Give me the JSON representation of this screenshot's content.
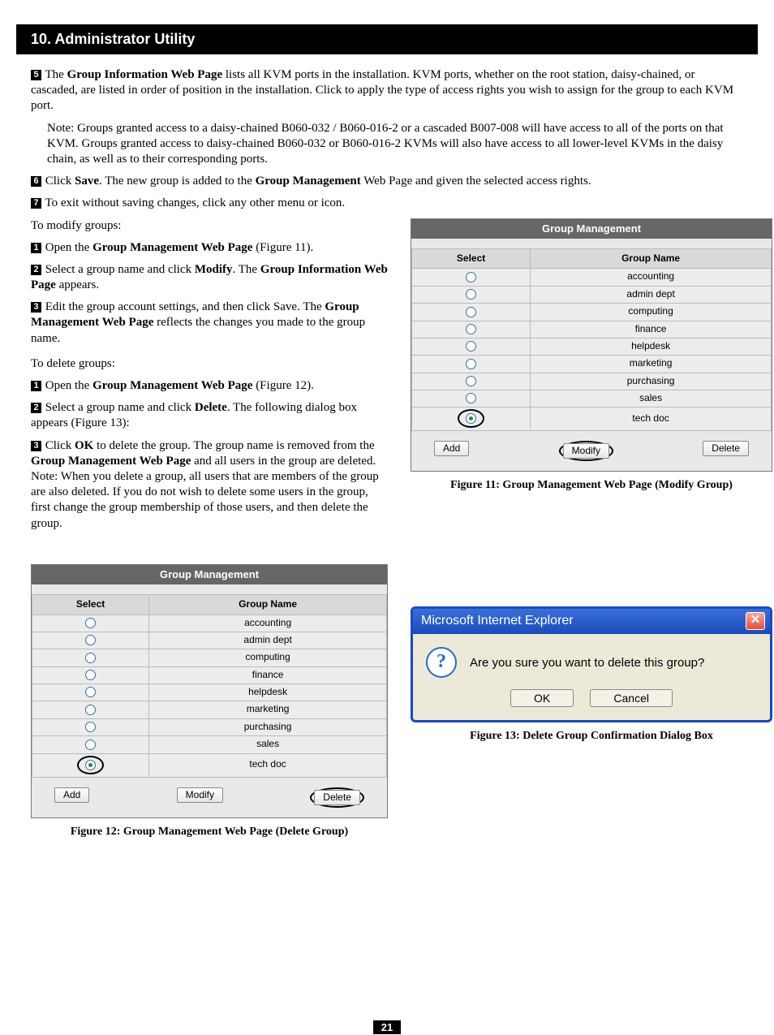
{
  "header": {
    "title": "10. Administrator Utility"
  },
  "page_number": "21",
  "top_paras": {
    "n5": "5",
    "p5a": "The ",
    "p5b_bold": "Group Information Web Page",
    "p5c": " lists all KVM ports in the installation. KVM ports, whether on the root station, daisy-chained, or cascaded, are listed in order of position in the installation. Click to apply the type of access rights you wish to assign for the group to each KVM port.",
    "note": "Note: Groups granted access to a daisy-chained B060-032 / B060-016-2 or a cascaded B007-008 will have access to all of the ports on that KVM. Groups granted access to daisy-chained B060-032 or B060-016-2 KVMs will also have access to all lower-level KVMs in the daisy chain, as well as to their corresponding ports.",
    "n6": "6",
    "p6a": "Click ",
    "p6b_bold": "Save",
    "p6c": ". The new group is added to the ",
    "p6d_bold": "Group Management",
    "p6e": " Web Page and given the selected access rights.",
    "n7": "7",
    "p7": "To exit without saving changes, click any other menu or icon."
  },
  "modify": {
    "heading": "To modify groups:",
    "n1": "1",
    "p1a": "Open the ",
    "p1b_bold": "Group Management Web Page",
    "p1c": " (Figure 11).",
    "n2": "2",
    "p2a": "Select a group name and click ",
    "p2b_bold": "Modify",
    "p2c": ". The ",
    "p2d_bold": "Group Information Web Page",
    "p2e": " appears.",
    "n3": "3",
    "p3a": "Edit the group account settings, and then click Save. The ",
    "p3b_bold": "Group Management Web Page",
    "p3c": " reflects the changes you made to the group name."
  },
  "del": {
    "heading": "To delete groups:",
    "n1": "1",
    "p1a": "Open the ",
    "p1b_bold": "Group Management Web Page",
    "p1c": " (Figure 12).",
    "n2": "2",
    "p2a": "Select a group name and click ",
    "p2b_bold": "Delete",
    "p2c": ". The following dialog box appears (Figure 13):",
    "n3": "3",
    "p3a": "Click ",
    "p3b_bold": "OK",
    "p3c": " to delete the group. The group name is removed from the ",
    "p3d_bold": "Group Management Web Page",
    "p3e": " and all users in the group are deleted. Note: When you delete a group, all users that are members of the group are also deleted. If you do not wish to delete some users in the group, first change the group membership of those users, and then delete the group."
  },
  "gm": {
    "title": "Group Management",
    "th_select": "Select",
    "th_name": "Group Name",
    "rows": [
      {
        "name": "accounting",
        "checked": false
      },
      {
        "name": "admin dept",
        "checked": false
      },
      {
        "name": "computing",
        "checked": false
      },
      {
        "name": "finance",
        "checked": false
      },
      {
        "name": "helpdesk",
        "checked": false
      },
      {
        "name": "marketing",
        "checked": false
      },
      {
        "name": "purchasing",
        "checked": false
      },
      {
        "name": "sales",
        "checked": false
      },
      {
        "name": "tech doc",
        "checked": true
      }
    ],
    "btn_add": "Add",
    "btn_modify": "Modify",
    "btn_delete": "Delete"
  },
  "figcap11": "Figure 11: Group Management Web Page (Modify Group)",
  "figcap12": "Figure 12: Group Management Web Page (Delete Group)",
  "figcap13": "Figure 13: Delete Group Confirmation Dialog Box",
  "dialog": {
    "title": "Microsoft Internet Explorer",
    "msg": "Are you sure you want to delete this group?",
    "ok": "OK",
    "cancel": "Cancel",
    "qmark": "?"
  }
}
